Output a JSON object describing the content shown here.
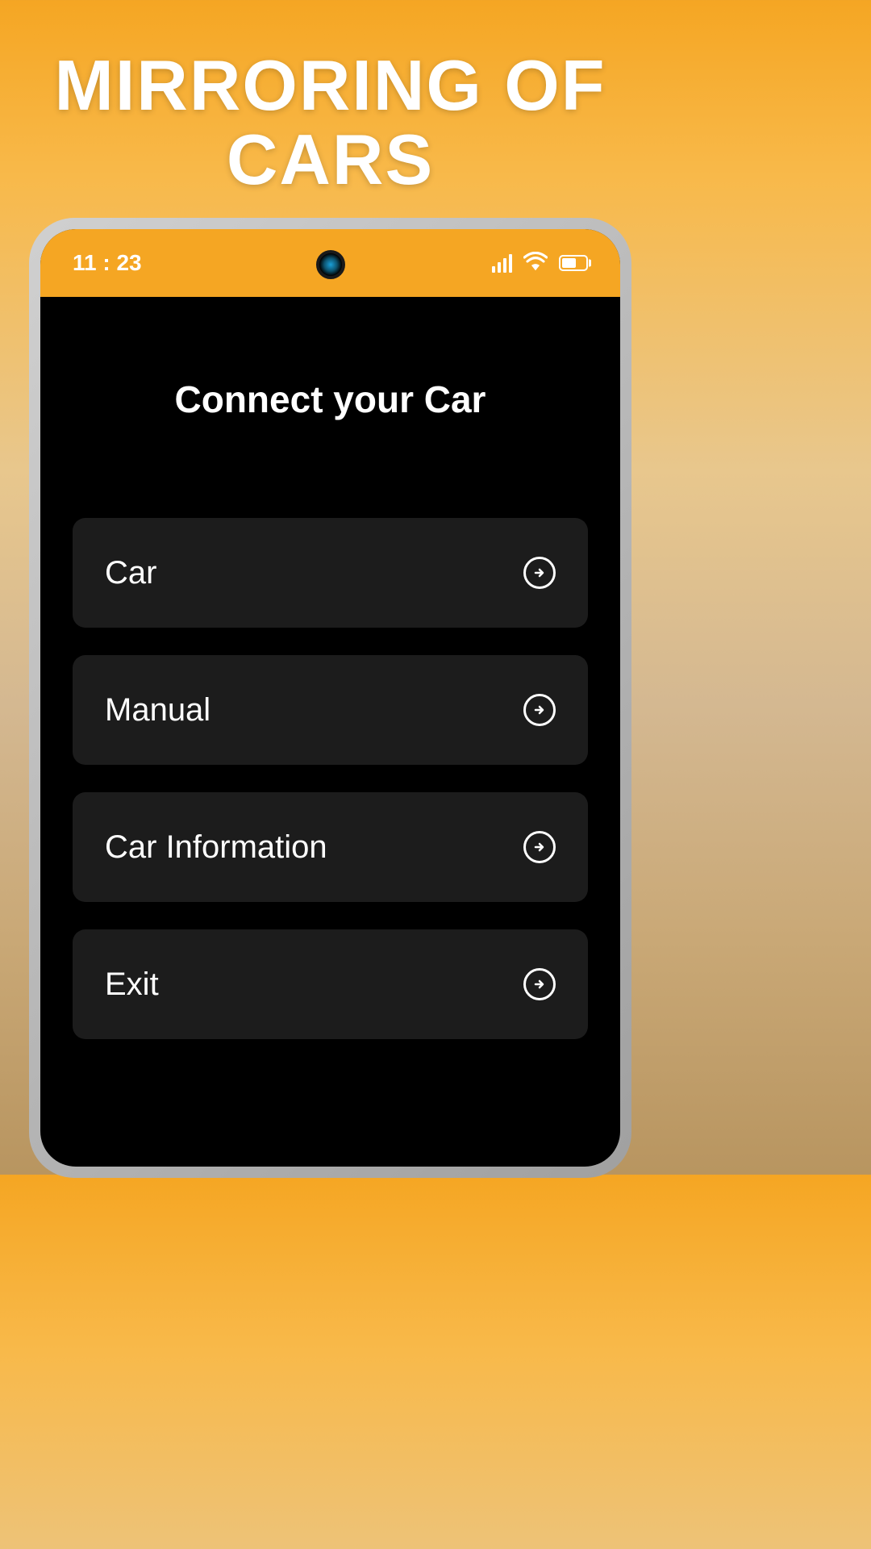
{
  "promo": {
    "title_line1": "MIRRORING OF",
    "title_line2": "CARS"
  },
  "status_bar": {
    "time": "11 : 23"
  },
  "screen": {
    "title": "Connect your Car",
    "menu_items": [
      {
        "label": "Car"
      },
      {
        "label": "Manual"
      },
      {
        "label": "Car Information"
      },
      {
        "label": "Exit"
      }
    ]
  }
}
